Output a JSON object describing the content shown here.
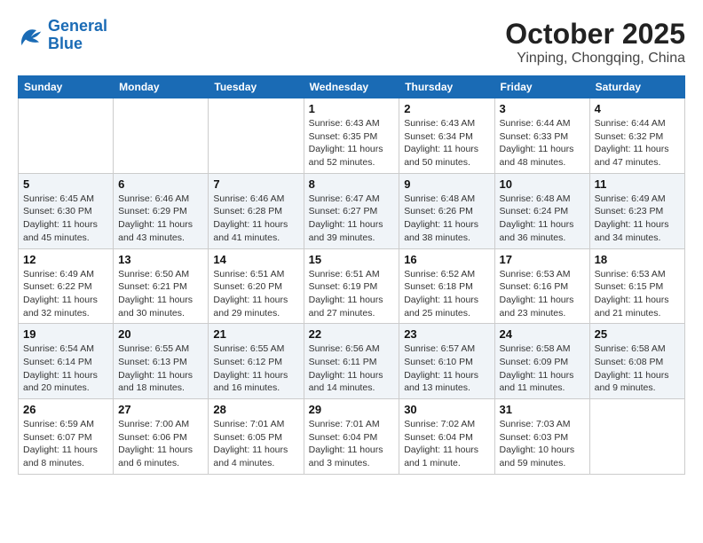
{
  "header": {
    "logo_text_general": "General",
    "logo_text_blue": "Blue",
    "month": "October 2025",
    "location": "Yinping, Chongqing, China"
  },
  "days_of_week": [
    "Sunday",
    "Monday",
    "Tuesday",
    "Wednesday",
    "Thursday",
    "Friday",
    "Saturday"
  ],
  "weeks": [
    [
      {
        "day": "",
        "info": ""
      },
      {
        "day": "",
        "info": ""
      },
      {
        "day": "",
        "info": ""
      },
      {
        "day": "1",
        "info": "Sunrise: 6:43 AM\nSunset: 6:35 PM\nDaylight: 11 hours and 52 minutes."
      },
      {
        "day": "2",
        "info": "Sunrise: 6:43 AM\nSunset: 6:34 PM\nDaylight: 11 hours and 50 minutes."
      },
      {
        "day": "3",
        "info": "Sunrise: 6:44 AM\nSunset: 6:33 PM\nDaylight: 11 hours and 48 minutes."
      },
      {
        "day": "4",
        "info": "Sunrise: 6:44 AM\nSunset: 6:32 PM\nDaylight: 11 hours and 47 minutes."
      }
    ],
    [
      {
        "day": "5",
        "info": "Sunrise: 6:45 AM\nSunset: 6:30 PM\nDaylight: 11 hours and 45 minutes."
      },
      {
        "day": "6",
        "info": "Sunrise: 6:46 AM\nSunset: 6:29 PM\nDaylight: 11 hours and 43 minutes."
      },
      {
        "day": "7",
        "info": "Sunrise: 6:46 AM\nSunset: 6:28 PM\nDaylight: 11 hours and 41 minutes."
      },
      {
        "day": "8",
        "info": "Sunrise: 6:47 AM\nSunset: 6:27 PM\nDaylight: 11 hours and 39 minutes."
      },
      {
        "day": "9",
        "info": "Sunrise: 6:48 AM\nSunset: 6:26 PM\nDaylight: 11 hours and 38 minutes."
      },
      {
        "day": "10",
        "info": "Sunrise: 6:48 AM\nSunset: 6:24 PM\nDaylight: 11 hours and 36 minutes."
      },
      {
        "day": "11",
        "info": "Sunrise: 6:49 AM\nSunset: 6:23 PM\nDaylight: 11 hours and 34 minutes."
      }
    ],
    [
      {
        "day": "12",
        "info": "Sunrise: 6:49 AM\nSunset: 6:22 PM\nDaylight: 11 hours and 32 minutes."
      },
      {
        "day": "13",
        "info": "Sunrise: 6:50 AM\nSunset: 6:21 PM\nDaylight: 11 hours and 30 minutes."
      },
      {
        "day": "14",
        "info": "Sunrise: 6:51 AM\nSunset: 6:20 PM\nDaylight: 11 hours and 29 minutes."
      },
      {
        "day": "15",
        "info": "Sunrise: 6:51 AM\nSunset: 6:19 PM\nDaylight: 11 hours and 27 minutes."
      },
      {
        "day": "16",
        "info": "Sunrise: 6:52 AM\nSunset: 6:18 PM\nDaylight: 11 hours and 25 minutes."
      },
      {
        "day": "17",
        "info": "Sunrise: 6:53 AM\nSunset: 6:16 PM\nDaylight: 11 hours and 23 minutes."
      },
      {
        "day": "18",
        "info": "Sunrise: 6:53 AM\nSunset: 6:15 PM\nDaylight: 11 hours and 21 minutes."
      }
    ],
    [
      {
        "day": "19",
        "info": "Sunrise: 6:54 AM\nSunset: 6:14 PM\nDaylight: 11 hours and 20 minutes."
      },
      {
        "day": "20",
        "info": "Sunrise: 6:55 AM\nSunset: 6:13 PM\nDaylight: 11 hours and 18 minutes."
      },
      {
        "day": "21",
        "info": "Sunrise: 6:55 AM\nSunset: 6:12 PM\nDaylight: 11 hours and 16 minutes."
      },
      {
        "day": "22",
        "info": "Sunrise: 6:56 AM\nSunset: 6:11 PM\nDaylight: 11 hours and 14 minutes."
      },
      {
        "day": "23",
        "info": "Sunrise: 6:57 AM\nSunset: 6:10 PM\nDaylight: 11 hours and 13 minutes."
      },
      {
        "day": "24",
        "info": "Sunrise: 6:58 AM\nSunset: 6:09 PM\nDaylight: 11 hours and 11 minutes."
      },
      {
        "day": "25",
        "info": "Sunrise: 6:58 AM\nSunset: 6:08 PM\nDaylight: 11 hours and 9 minutes."
      }
    ],
    [
      {
        "day": "26",
        "info": "Sunrise: 6:59 AM\nSunset: 6:07 PM\nDaylight: 11 hours and 8 minutes."
      },
      {
        "day": "27",
        "info": "Sunrise: 7:00 AM\nSunset: 6:06 PM\nDaylight: 11 hours and 6 minutes."
      },
      {
        "day": "28",
        "info": "Sunrise: 7:01 AM\nSunset: 6:05 PM\nDaylight: 11 hours and 4 minutes."
      },
      {
        "day": "29",
        "info": "Sunrise: 7:01 AM\nSunset: 6:04 PM\nDaylight: 11 hours and 3 minutes."
      },
      {
        "day": "30",
        "info": "Sunrise: 7:02 AM\nSunset: 6:04 PM\nDaylight: 11 hours and 1 minute."
      },
      {
        "day": "31",
        "info": "Sunrise: 7:03 AM\nSunset: 6:03 PM\nDaylight: 10 hours and 59 minutes."
      },
      {
        "day": "",
        "info": ""
      }
    ]
  ]
}
